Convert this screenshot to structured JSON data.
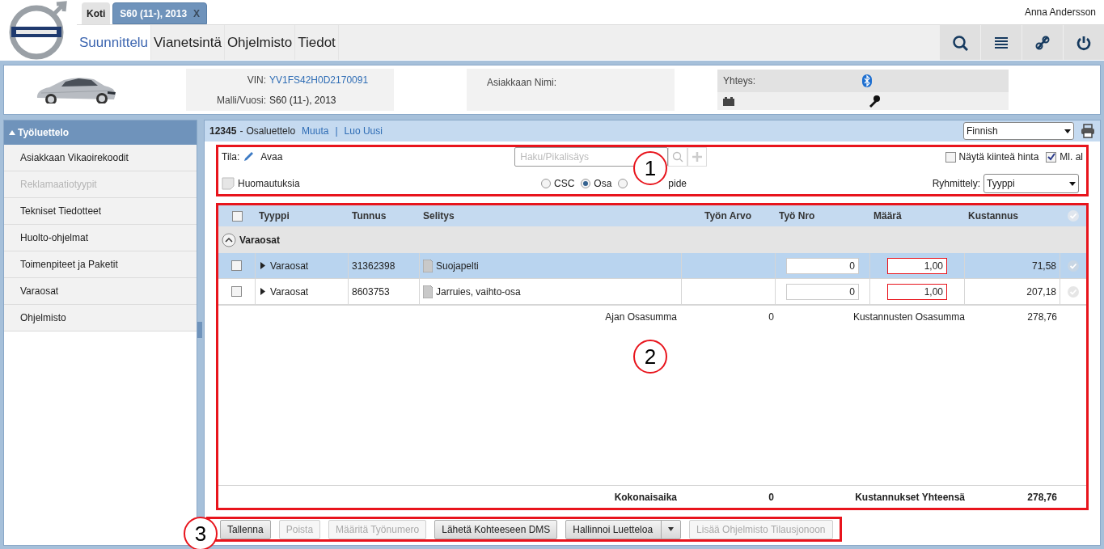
{
  "header": {
    "user": "Anna Andersson",
    "tabs": [
      {
        "label": "Koti",
        "selected": false
      },
      {
        "label": "S60 (11-), 2013",
        "selected": true,
        "close": "X"
      }
    ],
    "nav": [
      {
        "label": "Suunnittelu",
        "selected": true
      },
      {
        "label": "Vianetsintä",
        "selected": false
      },
      {
        "label": "Ohjelmisto",
        "selected": false
      },
      {
        "label": "Tiedot",
        "selected": false
      }
    ]
  },
  "vehicle": {
    "vin_label": "VIN:",
    "vin": "YV1FS42H0D2170091",
    "model_label": "Malli/Vuosi:",
    "model": "S60 (11-), 2013",
    "customer_label": "Asiakkaan Nimi:",
    "connection_label": "Yhteys:"
  },
  "sidebar": {
    "title": "Työluettelo",
    "expanded": true,
    "items": [
      {
        "label": "Asiakkaan Vikaoirekoodit",
        "disabled": false
      },
      {
        "label": "Reklamaatiotyypit",
        "disabled": true
      },
      {
        "label": "Tekniset Tiedotteet",
        "disabled": false
      },
      {
        "label": "Huolto-ohjelmat",
        "disabled": false
      },
      {
        "label": "Toimenpiteet ja Paketit",
        "disabled": false
      },
      {
        "label": "Varaosat",
        "disabled": false
      },
      {
        "label": "Ohjelmisto",
        "disabled": false
      }
    ]
  },
  "list_header": {
    "number": "12345",
    "separator": "-",
    "name": "Osaluettelo",
    "links": [
      "Muuta",
      "Luo Uusi"
    ],
    "divider": "|",
    "language": "Finnish"
  },
  "filters": {
    "status_label": "Tila:",
    "status": "Avaa",
    "notes": "Huomautuksia",
    "search_placeholder": "Haku/Pikalisäys",
    "radios": [
      {
        "label": "CSC",
        "selected": false
      },
      {
        "label": "Osa",
        "selected": true
      },
      {
        "label": "pide",
        "selected": false
      }
    ],
    "checkboxes": [
      {
        "label": "Näytä kiinteä hinta",
        "checked": false
      },
      {
        "label": "Ml. al",
        "checked": true
      }
    ],
    "grouping_label": "Ryhmittely:",
    "grouping": "Tyyppi"
  },
  "table": {
    "columns": [
      "Tyyppi",
      "Tunnus",
      "Selitys",
      "Työn Arvo",
      "Työ Nro",
      "Määrä",
      "Kustannus"
    ],
    "all_checked": false,
    "group": {
      "label": "Varaosat",
      "expanded": true
    },
    "rows": [
      {
        "type": "Varaosat",
        "code": "31362398",
        "description": "Suojapelti",
        "job_no": "0",
        "quantity": "1,00",
        "cost": "71,58",
        "selected": true,
        "checked": false
      },
      {
        "type": "Varaosat",
        "code": "8603753",
        "description": "Jarruies, vaihto-osa",
        "job_no": "0",
        "quantity": "1,00",
        "cost": "207,18",
        "selected": false,
        "checked": false
      }
    ],
    "subtotal": {
      "time_label": "Ajan Osasumma",
      "time": "0",
      "cost_label": "Kustannusten Osasumma",
      "cost": "278,76"
    },
    "total": {
      "time_label": "Kokonaisaika",
      "time": "0",
      "cost_label": "Kustannukset Yhteensä",
      "cost": "278,76"
    }
  },
  "buttons": [
    {
      "label": "Tallenna",
      "disabled": false,
      "kind": "plain"
    },
    {
      "label": "Poista",
      "disabled": true,
      "kind": "plain"
    },
    {
      "label": "Määritä Työnumero",
      "disabled": true,
      "kind": "plain"
    },
    {
      "label": "Lähetä Kohteeseen DMS",
      "disabled": false,
      "kind": "plain"
    },
    {
      "label": "Hallinnoi Luetteloa",
      "disabled": false,
      "kind": "split"
    },
    {
      "label": "Lisää Ohjelmisto Tilausjonoon",
      "disabled": true,
      "kind": "plain"
    }
  ],
  "annotations": [
    "1",
    "2",
    "3"
  ]
}
